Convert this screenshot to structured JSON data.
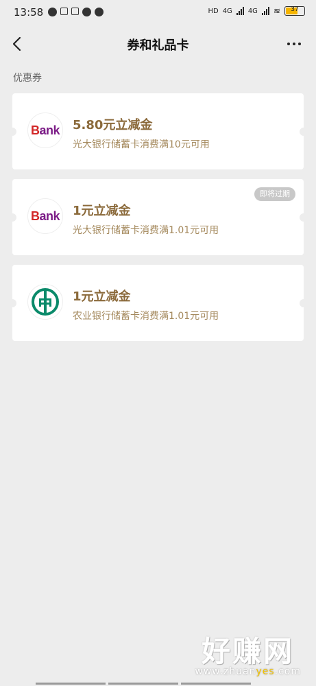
{
  "status_bar": {
    "time": "13:58",
    "net1": "HD",
    "net2": "4G",
    "net3": "4G",
    "battery": "37"
  },
  "header": {
    "title": "券和礼品卡"
  },
  "section": {
    "title": "优惠券"
  },
  "coupons": [
    {
      "title": "5.80元立减金",
      "desc": "光大银行储蓄卡消费满10元可用",
      "logo": "Bank",
      "badge": ""
    },
    {
      "title": "1元立减金",
      "desc": "光大银行储蓄卡消费满1.01元可用",
      "logo": "Bank",
      "badge": "即将过期"
    },
    {
      "title": "1元立减金",
      "desc": "农业银行储蓄卡消费满1.01元可用",
      "logo": "abc-logo",
      "badge": ""
    }
  ],
  "watermark": {
    "main": "好赚网",
    "site_a": "www.zhuan",
    "site_b": "yes",
    "site_c": ".com"
  },
  "colors": {
    "background": "#ededed",
    "title_gold": "#8b6a3b",
    "desc_gold": "#a58a5e",
    "abc_green": "#0a8a6a",
    "ceb_purple": "#7b1b86"
  }
}
